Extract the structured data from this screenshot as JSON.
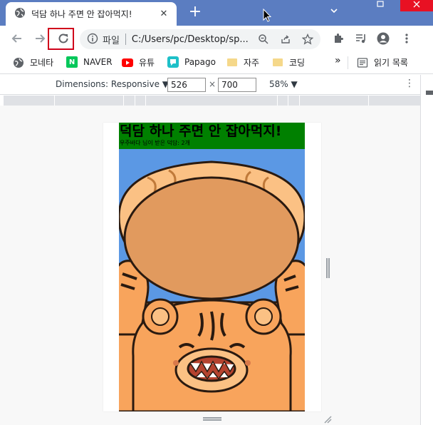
{
  "tab": {
    "title": "덕담 하나 주면 안 잡아먹지!",
    "close_glyph": "✕",
    "new_tab_glyph": "+"
  },
  "toolbar": {
    "url_scheme_label": "파일",
    "url": "C:/Users/pc/Desktop/sp..."
  },
  "bookmarks": [
    {
      "label": "모네타",
      "icon": "globe-icon"
    },
    {
      "label": "NAVER",
      "icon": "naver-icon",
      "badge": "N"
    },
    {
      "label": "유튜",
      "icon": "youtube-icon"
    },
    {
      "label": "Papago",
      "icon": "papago-icon"
    },
    {
      "label": "자주",
      "icon": "folder-icon"
    },
    {
      "label": "코딩",
      "icon": "folder-icon"
    }
  ],
  "bookmarks_overflow": "»",
  "reading_list_label": "읽기 목록",
  "device_toolbar": {
    "dimensions_label": "Dimensions: Responsive ▼",
    "width": "526",
    "times": "×",
    "height": "700",
    "zoom": "58% ▼",
    "more": "⋮"
  },
  "page": {
    "title": "덕담 하나 주면 안 잡아먹지!",
    "subtitle": "우주바다 님이 받은 덕담: 2개"
  },
  "colors": {
    "tabstrip": "#5b7dc1",
    "page_header": "#008000",
    "image_bg": "#5b98e4",
    "tiger_orange": "#f8a45c",
    "rice_cake": "#e19a5e",
    "highlight_red": "#d0021b"
  }
}
